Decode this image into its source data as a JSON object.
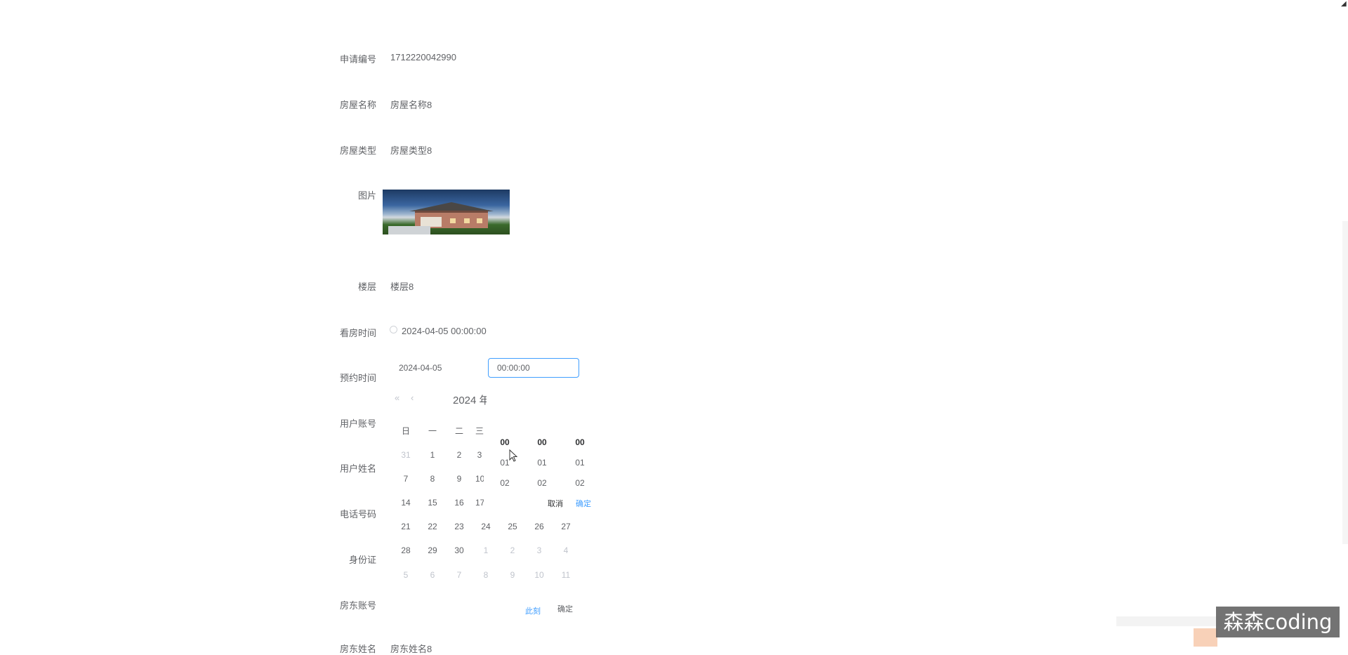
{
  "form": {
    "fields": [
      {
        "label": "申请编号",
        "value": "1712220042990"
      },
      {
        "label": "房屋名称",
        "value": "房屋名称8"
      },
      {
        "label": "房屋类型",
        "value": "房屋类型8"
      },
      {
        "label": "图片",
        "value": ""
      },
      {
        "label": "楼层",
        "value": "楼层8"
      },
      {
        "label": "看房时间",
        "value": "2024-04-05 00:00:00"
      },
      {
        "label": "预约时间",
        "value": ""
      },
      {
        "label": "用户账号",
        "value": ""
      },
      {
        "label": "用户姓名",
        "value": ""
      },
      {
        "label": "电话号码",
        "value": ""
      },
      {
        "label": "身份证",
        "value": ""
      },
      {
        "label": "房东账号",
        "value": ""
      },
      {
        "label": "房东姓名",
        "value": "房东姓名8"
      }
    ],
    "photo_icon": "house-photo"
  },
  "picker": {
    "date_value": "2024-04-05",
    "time_value": "00:00:00",
    "header_title": "2024 年",
    "weekdays": [
      "日",
      "一",
      "二",
      "三"
    ],
    "weeks": [
      [
        {
          "d": "31",
          "o": true
        },
        {
          "d": "1",
          "o": false
        },
        {
          "d": "2",
          "o": false
        },
        {
          "d": "3",
          "o": false
        }
      ],
      [
        {
          "d": "7",
          "o": false
        },
        {
          "d": "8",
          "o": false
        },
        {
          "d": "9",
          "o": false
        },
        {
          "d": "10",
          "o": false
        }
      ],
      [
        {
          "d": "14",
          "o": false
        },
        {
          "d": "15",
          "o": false
        },
        {
          "d": "16",
          "o": false
        },
        {
          "d": "17",
          "o": false
        }
      ],
      [
        {
          "d": "21",
          "o": false
        },
        {
          "d": "22",
          "o": false
        },
        {
          "d": "23",
          "o": false
        },
        {
          "d": "24",
          "o": false
        },
        {
          "d": "25",
          "o": false
        },
        {
          "d": "26",
          "o": false
        },
        {
          "d": "27",
          "o": false
        }
      ],
      [
        {
          "d": "28",
          "o": false
        },
        {
          "d": "29",
          "o": false
        },
        {
          "d": "30",
          "o": false
        },
        {
          "d": "1",
          "o": true
        },
        {
          "d": "2",
          "o": true
        },
        {
          "d": "3",
          "o": true
        },
        {
          "d": "4",
          "o": true
        }
      ],
      [
        {
          "d": "5",
          "o": true
        },
        {
          "d": "6",
          "o": true
        },
        {
          "d": "7",
          "o": true
        },
        {
          "d": "8",
          "o": true
        },
        {
          "d": "9",
          "o": true
        },
        {
          "d": "10",
          "o": true
        },
        {
          "d": "11",
          "o": true
        }
      ]
    ],
    "time_spinner": {
      "hours": [
        "00",
        "01",
        "02"
      ],
      "minutes": [
        "00",
        "01",
        "02"
      ],
      "seconds": [
        "00",
        "01",
        "02"
      ],
      "cancel_label": "取消",
      "ok_label": "确定"
    },
    "now_label": "此刻",
    "confirm_label": "确定",
    "icons": {
      "prev_year": "double-chevron-left-icon",
      "prev_month": "chevron-left-icon",
      "clock": "clock-icon"
    }
  },
  "watermark": {
    "text": "森森coding"
  },
  "colors": {
    "accent": "#409eff",
    "text": "#606266",
    "muted": "#c0c4cc"
  }
}
